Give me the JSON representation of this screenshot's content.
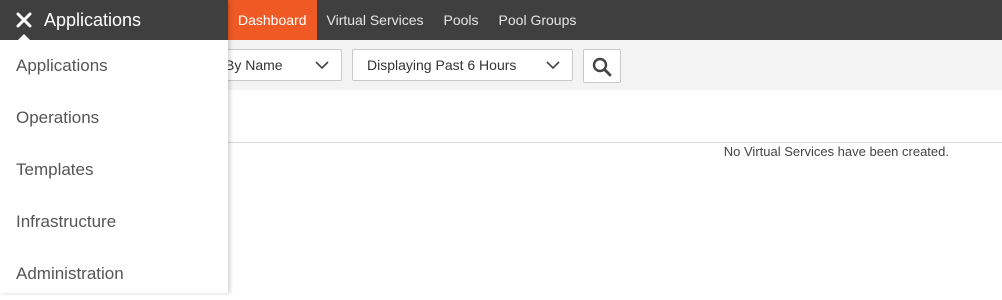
{
  "topbar": {
    "tabs": [
      {
        "label": "Dashboard"
      },
      {
        "label": "Virtual Services"
      },
      {
        "label": "Pools"
      },
      {
        "label": "Pool Groups"
      }
    ]
  },
  "toolbar": {
    "sort_value": "By Name",
    "time_value": "Displaying Past 6 Hours"
  },
  "content": {
    "empty_message": "No Virtual Services have been created."
  },
  "drawer": {
    "title": "Applications",
    "items": [
      {
        "label": "Applications"
      },
      {
        "label": "Operations"
      },
      {
        "label": "Templates"
      },
      {
        "label": "Infrastructure"
      },
      {
        "label": "Administration"
      }
    ]
  },
  "colors": {
    "topbar_bg": "#3f3f3f",
    "active_tab": "#ef5a24",
    "toolbar_bg": "#f3f3f3"
  }
}
